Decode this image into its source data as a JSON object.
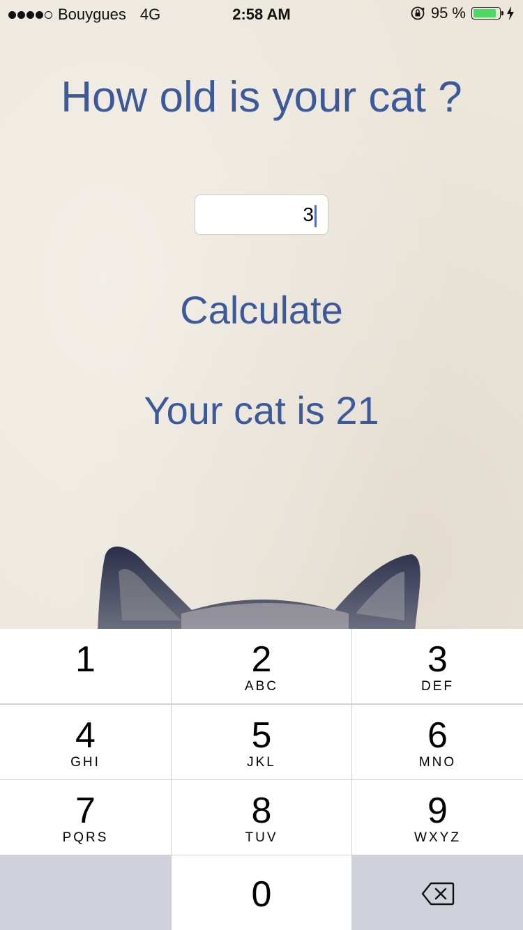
{
  "status_bar": {
    "carrier": "Bouygues",
    "network": "4G",
    "time": "2:58 AM",
    "battery_percent_label": "95 %",
    "battery_level": 0.95
  },
  "app": {
    "title": "How old is your cat ?",
    "input_value": "3",
    "calculate_label": "Calculate",
    "result_text": "Your cat is 21"
  },
  "keypad": {
    "keys": [
      {
        "num": "1",
        "letters": ""
      },
      {
        "num": "2",
        "letters": "ABC"
      },
      {
        "num": "3",
        "letters": "DEF"
      },
      {
        "num": "4",
        "letters": "GHI"
      },
      {
        "num": "5",
        "letters": "JKL"
      },
      {
        "num": "6",
        "letters": "MNO"
      },
      {
        "num": "7",
        "letters": "PQRS"
      },
      {
        "num": "8",
        "letters": "TUV"
      },
      {
        "num": "9",
        "letters": "WXYZ"
      },
      {
        "num": "0",
        "letters": ""
      }
    ]
  },
  "colors": {
    "accent_text": "#3c5a9a",
    "battery_green": "#4cd964",
    "caret": "#3f6fe8"
  }
}
